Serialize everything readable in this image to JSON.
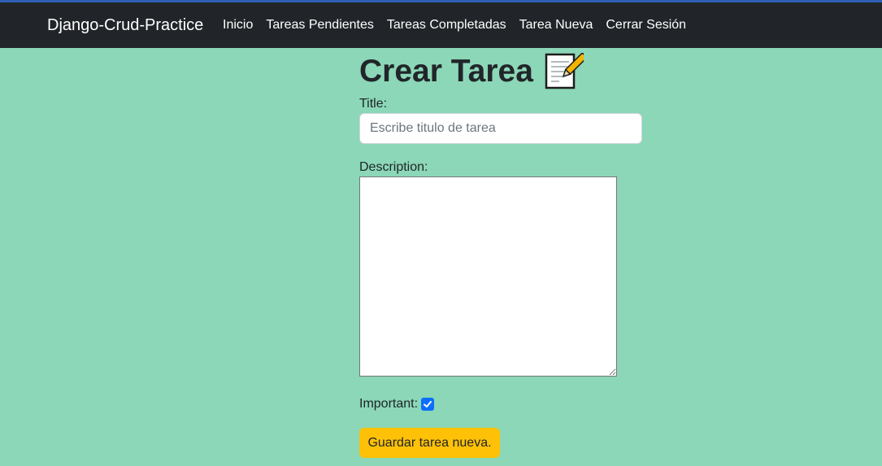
{
  "navbar": {
    "brand": "Django-Crud-Practice",
    "links": [
      {
        "label": "Inicio"
      },
      {
        "label": "Tareas Pendientes"
      },
      {
        "label": "Tareas Completadas"
      },
      {
        "label": "Tarea Nueva"
      },
      {
        "label": "Cerrar Sesión"
      }
    ]
  },
  "form": {
    "heading": "Crear Tarea",
    "heading_icon": "memo-icon",
    "title_label": "Title:",
    "title_placeholder": "Escribe titulo de tarea",
    "title_value": "",
    "description_label": "Description:",
    "description_value": "",
    "important_label": "Important:",
    "important_checked": true,
    "submit_label": "Guardar tarea nueva."
  },
  "colors": {
    "background": "#8bd7b7",
    "navbar": "#212529",
    "button": "#ffc107",
    "checkbox": "#0d6efd"
  }
}
